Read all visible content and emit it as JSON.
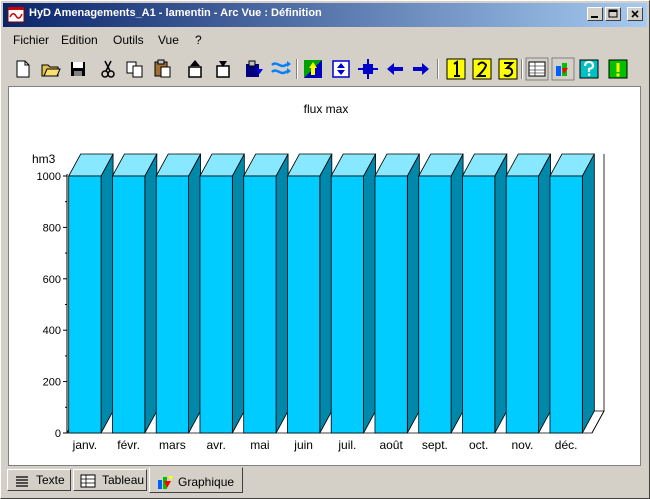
{
  "window": {
    "title": "HyD Amenagements_A1 - lamentin - Arc Vue  : Définition"
  },
  "menu": {
    "items": [
      {
        "label": "Fichier"
      },
      {
        "label": "Edition"
      },
      {
        "label": "Outils"
      },
      {
        "label": "Vue"
      },
      {
        "label": "?"
      }
    ]
  },
  "toolbar": {
    "icons": [
      "new-file-icon",
      "open-folder-icon",
      "save-icon",
      "cut-icon",
      "copy-icon",
      "paste-icon",
      "move-up-icon",
      "move-down-icon",
      "import-icon",
      "swap-icon",
      "color-up-icon",
      "expand-icon",
      "select-icon",
      "arrow-left-icon",
      "arrow-right-icon",
      "view-1-icon",
      "view-2-icon",
      "view-3-icon",
      "table-view-icon",
      "chart-view-icon",
      "help-icon",
      "info-icon"
    ],
    "accent": "#0000cc"
  },
  "chart_data": {
    "type": "bar",
    "title": "flux max",
    "ylabel": "hm3",
    "ylim": [
      0,
      1000
    ],
    "yticks": [
      0,
      200,
      400,
      600,
      800,
      1000
    ],
    "categories": [
      "janv.",
      "févr.",
      "mars",
      "avr.",
      "mai",
      "juin",
      "juil.",
      "août",
      "sept.",
      "oct.",
      "nov.",
      "déc."
    ],
    "values": [
      1000,
      1000,
      1000,
      1000,
      1000,
      1000,
      1000,
      1000,
      1000,
      1000,
      1000,
      1000
    ],
    "colors": {
      "front": "#00ccff",
      "top": "#88e8ff",
      "side": "#0088aa"
    },
    "grid": false,
    "style": "3d"
  },
  "tabs": [
    {
      "label": "Texte",
      "active": false
    },
    {
      "label": "Tableau",
      "active": false
    },
    {
      "label": "Graphique",
      "active": true
    }
  ]
}
